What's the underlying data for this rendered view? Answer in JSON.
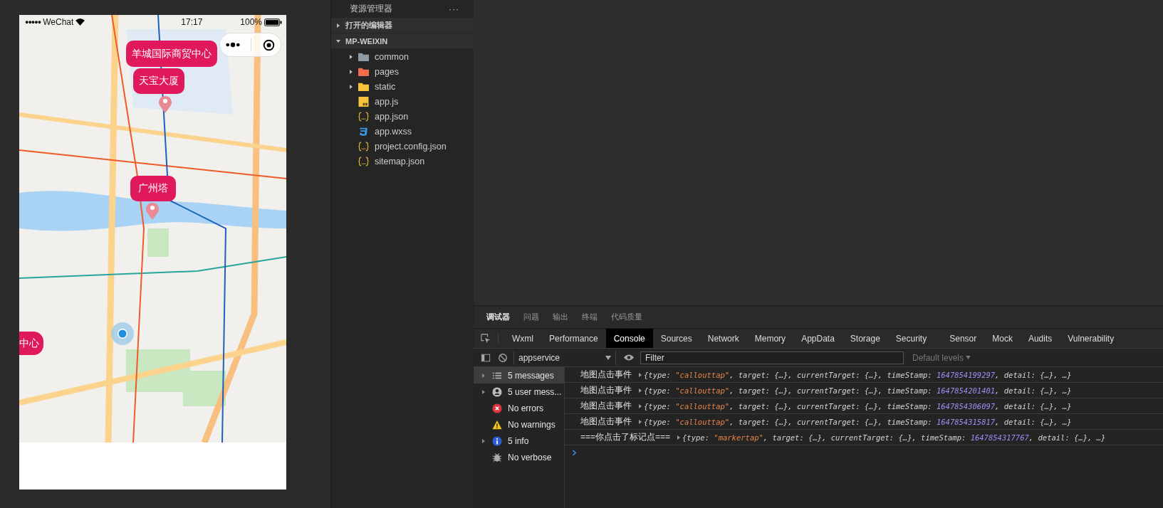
{
  "simulator": {
    "status_bar": {
      "signal": "●●●●●",
      "carrier": "WeChat",
      "time": "17:17",
      "battery": "100%"
    },
    "map": {
      "kind": "picture",
      "callouts": [
        {
          "label": "羊城国际商贸中心",
          "kind": "full"
        },
        {
          "label": "天宝大厦",
          "kind": "full"
        },
        {
          "label": "广州塔",
          "kind": "full"
        },
        {
          "label": "中心",
          "kind": "edge"
        }
      ]
    }
  },
  "explorer": {
    "title": "资源管理器",
    "menu": "···",
    "sections": [
      {
        "label": "打开的编辑器",
        "expanded": false
      },
      {
        "label": "MP-WEIXIN",
        "expanded": true
      }
    ],
    "items": [
      {
        "name": "common",
        "kind": "folder",
        "color": "#8e9aa3"
      },
      {
        "name": "pages",
        "kind": "folder",
        "color": "#f26b4a"
      },
      {
        "name": "static",
        "kind": "folder",
        "color": "#f5c33b"
      },
      {
        "name": "app.js",
        "kind": "js"
      },
      {
        "name": "app.json",
        "kind": "json"
      },
      {
        "name": "app.wxss",
        "kind": "css"
      },
      {
        "name": "project.config.json",
        "kind": "json"
      },
      {
        "name": "sitemap.json",
        "kind": "json"
      }
    ]
  },
  "devtools": {
    "panel_tabs": [
      {
        "label": "调试器",
        "selected": true
      },
      {
        "label": "问题",
        "selected": false
      },
      {
        "label": "输出",
        "selected": false
      },
      {
        "label": "终端",
        "selected": false
      },
      {
        "label": "代码质量",
        "selected": false
      }
    ],
    "tool_tabs": [
      {
        "label": "Wxml",
        "selected": false
      },
      {
        "label": "Performance",
        "selected": false
      },
      {
        "label": "Console",
        "selected": true
      },
      {
        "label": "Sources",
        "selected": false
      },
      {
        "label": "Network",
        "selected": false
      },
      {
        "label": "Memory",
        "selected": false
      },
      {
        "label": "AppData",
        "selected": false
      },
      {
        "label": "Storage",
        "selected": false
      },
      {
        "label": "Security",
        "selected": false
      },
      {
        "label": "Sensor",
        "selected": false
      },
      {
        "label": "Mock",
        "selected": false
      },
      {
        "label": "Audits",
        "selected": false
      },
      {
        "label": "Vulnerability",
        "selected": false
      }
    ],
    "context": "appservice",
    "filter": {
      "placeholder": "Filter"
    },
    "levels": "Default levels",
    "sidebar": [
      {
        "label": "5 messages",
        "kind": "messages",
        "expandable": true,
        "selected": true
      },
      {
        "label": "5 user mess...",
        "kind": "user",
        "expandable": true,
        "selected": false
      },
      {
        "label": "No errors",
        "kind": "error",
        "expandable": false,
        "selected": false
      },
      {
        "label": "No warnings",
        "kind": "warning",
        "expandable": false,
        "selected": false
      },
      {
        "label": "5 info",
        "kind": "info",
        "expandable": true,
        "selected": false
      },
      {
        "label": "No verbose",
        "kind": "verbose",
        "expandable": false,
        "selected": false
      }
    ],
    "logs": [
      {
        "label": "地图点击事件",
        "parts": [
          {
            "text": "{type: ",
            "kind": "plain"
          },
          {
            "text": "\"callouttap\"",
            "kind": "string"
          },
          {
            "text": ", target: {…}, currentTarget: {…}, timeStamp: ",
            "kind": "plain"
          },
          {
            "text": "1647854199297",
            "kind": "number"
          },
          {
            "text": ", detail: {…}, …}",
            "kind": "plain"
          }
        ]
      },
      {
        "label": "地图点击事件",
        "parts": [
          {
            "text": "{type: ",
            "kind": "plain"
          },
          {
            "text": "\"callouttap\"",
            "kind": "string"
          },
          {
            "text": ", target: {…}, currentTarget: {…}, timeStamp: ",
            "kind": "plain"
          },
          {
            "text": "1647854201401",
            "kind": "number"
          },
          {
            "text": ", detail: {…}, …}",
            "kind": "plain"
          }
        ]
      },
      {
        "label": "地图点击事件",
        "parts": [
          {
            "text": "{type: ",
            "kind": "plain"
          },
          {
            "text": "\"callouttap\"",
            "kind": "string"
          },
          {
            "text": ", target: {…}, currentTarget: {…}, timeStamp: ",
            "kind": "plain"
          },
          {
            "text": "1647854306097",
            "kind": "number"
          },
          {
            "text": ", detail: {…}, …}",
            "kind": "plain"
          }
        ]
      },
      {
        "label": "地图点击事件",
        "parts": [
          {
            "text": "{type: ",
            "kind": "plain"
          },
          {
            "text": "\"callouttap\"",
            "kind": "string"
          },
          {
            "text": ", target: {…}, currentTarget: {…}, timeStamp: ",
            "kind": "plain"
          },
          {
            "text": "1647854315817",
            "kind": "number"
          },
          {
            "text": ", detail: {…}, …}",
            "kind": "plain"
          }
        ]
      },
      {
        "label": "===你点击了标记点===",
        "parts": [
          {
            "text": "{type: ",
            "kind": "plain"
          },
          {
            "text": "\"markertap\"",
            "kind": "string"
          },
          {
            "text": ", target: {…}, currentTarget: {…}, timeStamp: ",
            "kind": "plain"
          },
          {
            "text": "1647854317767",
            "kind": "number"
          },
          {
            "text": ", detail: {…}, …}",
            "kind": "plain"
          }
        ]
      }
    ]
  }
}
